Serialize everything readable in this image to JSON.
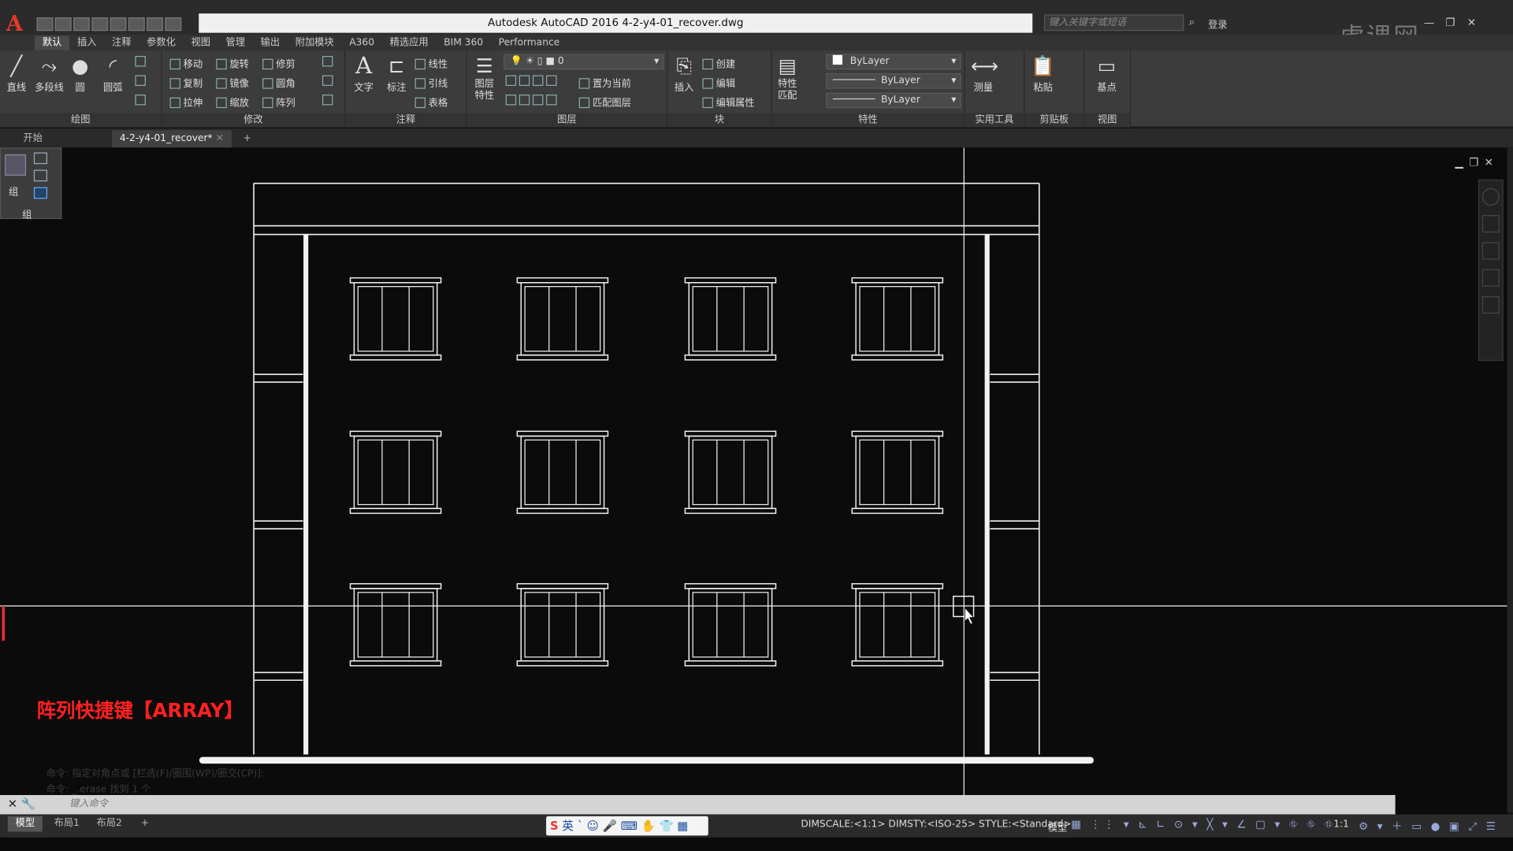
{
  "app": {
    "logo": "A",
    "window_title": "Autodesk AutoCAD 2016    4-2-y4-01_recover.dwg",
    "search_placeholder": "键入关键字或短语",
    "login_label": "登录",
    "watermark": "虎课网"
  },
  "ribbon_tabs": [
    "默认",
    "插入",
    "注释",
    "参数化",
    "视图",
    "管理",
    "输出",
    "附加模块",
    "A360",
    "精选应用",
    "BIM 360",
    "Performance"
  ],
  "ribbon": {
    "draw": {
      "label": "绘图",
      "line": "直线",
      "polyline": "多段线",
      "circle": "圆",
      "arc": "圆弧"
    },
    "modify": {
      "label": "修改",
      "move": "移动",
      "rotate": "旋转",
      "trim": "修剪",
      "copy": "复制",
      "mirror": "镜像",
      "fillet": "圆角",
      "stretch": "拉伸",
      "scale": "缩放",
      "array": "阵列"
    },
    "annotation": {
      "label": "注释",
      "text": "文字",
      "dimension": "标注",
      "linear": "线性",
      "leader": "引线",
      "table": "表格"
    },
    "layers": {
      "label": "图层",
      "layer_props": "图层特性",
      "current_layer": "0",
      "set_current": "置为当前",
      "match_layer": "匹配图层"
    },
    "block": {
      "label": "块",
      "insert": "插入",
      "create": "创建",
      "edit": "编辑",
      "edit_attr": "编辑属性"
    },
    "properties": {
      "label": "特性",
      "match": "特性匹配",
      "color": "ByLayer",
      "linetype": "ByLayer",
      "lineweight": "ByLayer"
    },
    "utilities": {
      "label": "实用工具",
      "measure": "测量"
    },
    "clipboard": {
      "label": "剪贴板",
      "paste": "粘贴"
    },
    "view": {
      "label": "视图",
      "base": "基点"
    }
  },
  "file_tabs": {
    "start": "开始",
    "active": "4-2-y4-01_recover*",
    "add": "+"
  },
  "group_panel": {
    "label1": "组",
    "label2": "组"
  },
  "canvas": {
    "shortcut_note": "阵列快捷键【ARRAY】",
    "history": [
      "命令: 指定对角点或 [栏选(F)/圈围(WP)/圈交(CP)]:",
      "命令: _.erase 找到 1 个"
    ]
  },
  "command_line": {
    "placeholder": "键入命令"
  },
  "layout_tabs": [
    "模型",
    "布局1",
    "布局2",
    "+"
  ],
  "ime": {
    "lang": "英"
  },
  "status": {
    "text": "DIMSCALE:<1:1> DIMSTY:<ISO-25> STYLE:<Standard>",
    "model": "模型",
    "scale": "1:1"
  },
  "colors": {
    "red_note": "#ff2020",
    "background": "#0b0b0b",
    "ribbon": "#3c3c3c"
  }
}
